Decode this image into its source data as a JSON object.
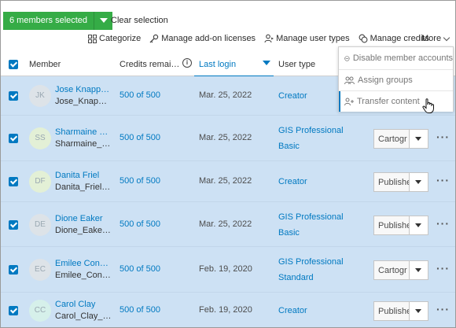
{
  "selection": {
    "count_label": "6 members selected",
    "clear_label": "Clear selection"
  },
  "toolbar": {
    "categorize": "Categorize",
    "addons": "Manage add-on licenses",
    "user_types": "Manage user types",
    "credits": "Manage credits",
    "more": "More"
  },
  "menu": {
    "items": [
      {
        "label": "Disable member accounts",
        "icon": "disable-icon"
      },
      {
        "label": "Assign groups",
        "icon": "groups-icon"
      },
      {
        "label": "Transfer content",
        "icon": "transfer-icon"
      }
    ]
  },
  "table": {
    "headers": {
      "member": "Member",
      "credits": "Credits remai…",
      "last_login": "Last login",
      "user_type": "User type"
    },
    "rows": [
      {
        "initials": "JK",
        "name": "Jose Knapp…",
        "username": "Jose_Knap…",
        "credits": "500 of 500",
        "last_login": "Mar. 25, 2022",
        "type1": "Creator",
        "type2": "",
        "role": "",
        "avatar_color": "#dde3e8"
      },
      {
        "initials": "SS",
        "name": "Sharmaine …",
        "username": "Sharmaine_…",
        "credits": "500 of 500",
        "last_login": "Mar. 25, 2022",
        "type1": "GIS Professional",
        "type2": "Basic",
        "role": "Cartogr",
        "avatar_color": "#e3f0d6"
      },
      {
        "initials": "DF",
        "name": "Danita Friel",
        "username": "Danita_Friel…",
        "credits": "500 of 500",
        "last_login": "Mar. 25, 2022",
        "type1": "Creator",
        "type2": "",
        "role": "Publishe",
        "avatar_color": "#e3f0d6"
      },
      {
        "initials": "DE",
        "name": "Dione Eaker",
        "username": "Dione_Eake…",
        "credits": "500 of 500",
        "last_login": "Mar. 25, 2022",
        "type1": "GIS Professional",
        "type2": "Basic",
        "role": "Publishe",
        "avatar_color": "#dde3e8"
      },
      {
        "initials": "EC",
        "name": "Emilee Con…",
        "username": "Emilee_Con…",
        "credits": "500 of 500",
        "last_login": "Feb. 19, 2020",
        "type1": "GIS Professional",
        "type2": "Standard",
        "role": "Cartogr",
        "avatar_color": "#dde3e8"
      },
      {
        "initials": "CC",
        "name": "Carol Clay",
        "username": "Carol_Clay_…",
        "credits": "500 of 500",
        "last_login": "Feb. 19, 2020",
        "type1": "Creator",
        "type2": "",
        "role": "Publishe",
        "avatar_color": "#d6f0ea"
      }
    ]
  },
  "colors": {
    "accent": "#0079c1",
    "selected_row": "#cde1f4",
    "green_button": "#35ac46"
  }
}
